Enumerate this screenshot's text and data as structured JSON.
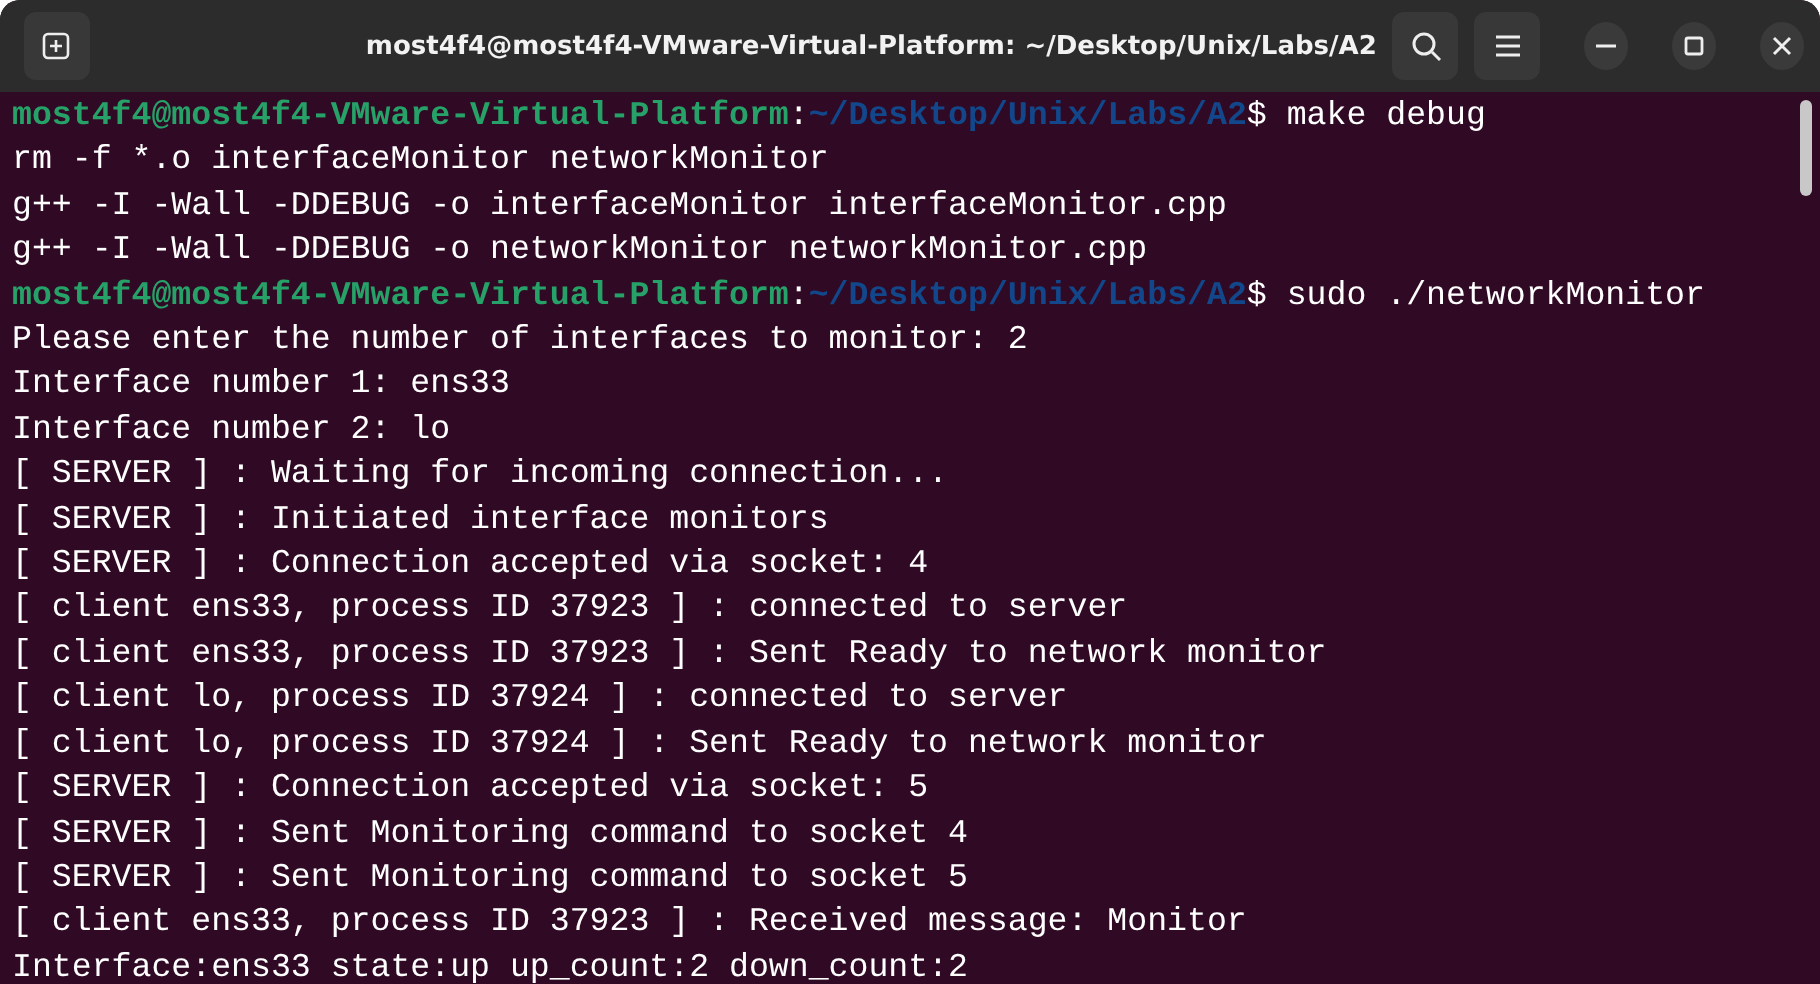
{
  "window": {
    "title": "most4f4@most4f4-VMware-Virtual-Platform: ~/Desktop/Unix/Labs/A2"
  },
  "terminal": {
    "lines": [
      {
        "kind": "prompt",
        "user_host": "most4f4@most4f4-VMware-Virtual-Platform",
        "separator": ":",
        "path": "~/Desktop/Unix/Labs/A2",
        "symbol": "$",
        "command": " make debug"
      },
      {
        "kind": "output",
        "text": "rm -f *.o interfaceMonitor networkMonitor"
      },
      {
        "kind": "output",
        "text": "g++ -I -Wall -DDEBUG -o interfaceMonitor interfaceMonitor.cpp"
      },
      {
        "kind": "output",
        "text": "g++ -I -Wall -DDEBUG -o networkMonitor networkMonitor.cpp"
      },
      {
        "kind": "prompt",
        "user_host": "most4f4@most4f4-VMware-Virtual-Platform",
        "separator": ":",
        "path": "~/Desktop/Unix/Labs/A2",
        "symbol": "$",
        "command": " sudo ./networkMonitor"
      },
      {
        "kind": "output",
        "text": "Please enter the number of interfaces to monitor: 2"
      },
      {
        "kind": "output",
        "text": "Interface number 1: ens33"
      },
      {
        "kind": "output",
        "text": "Interface number 2: lo"
      },
      {
        "kind": "output",
        "text": "[ SERVER ] : Waiting for incoming connection..."
      },
      {
        "kind": "output",
        "text": "[ SERVER ] : Initiated interface monitors"
      },
      {
        "kind": "output",
        "text": "[ SERVER ] : Connection accepted via socket: 4"
      },
      {
        "kind": "output",
        "text": "[ client ens33, process ID 37923 ] : connected to server"
      },
      {
        "kind": "output",
        "text": "[ client ens33, process ID 37923 ] : Sent Ready to network monitor"
      },
      {
        "kind": "output",
        "text": "[ client lo, process ID 37924 ] : connected to server"
      },
      {
        "kind": "output",
        "text": "[ client lo, process ID 37924 ] : Sent Ready to network monitor"
      },
      {
        "kind": "output",
        "text": "[ SERVER ] : Connection accepted via socket: 5"
      },
      {
        "kind": "output",
        "text": "[ SERVER ] : Sent Monitoring command to socket 4"
      },
      {
        "kind": "output",
        "text": "[ SERVER ] : Sent Monitoring command to socket 5"
      },
      {
        "kind": "output",
        "text": "[ client ens33, process ID 37923 ] : Received message: Monitor"
      },
      {
        "kind": "output",
        "text": "Interface:ens33 state:up up_count:2 down_count:2"
      }
    ]
  }
}
